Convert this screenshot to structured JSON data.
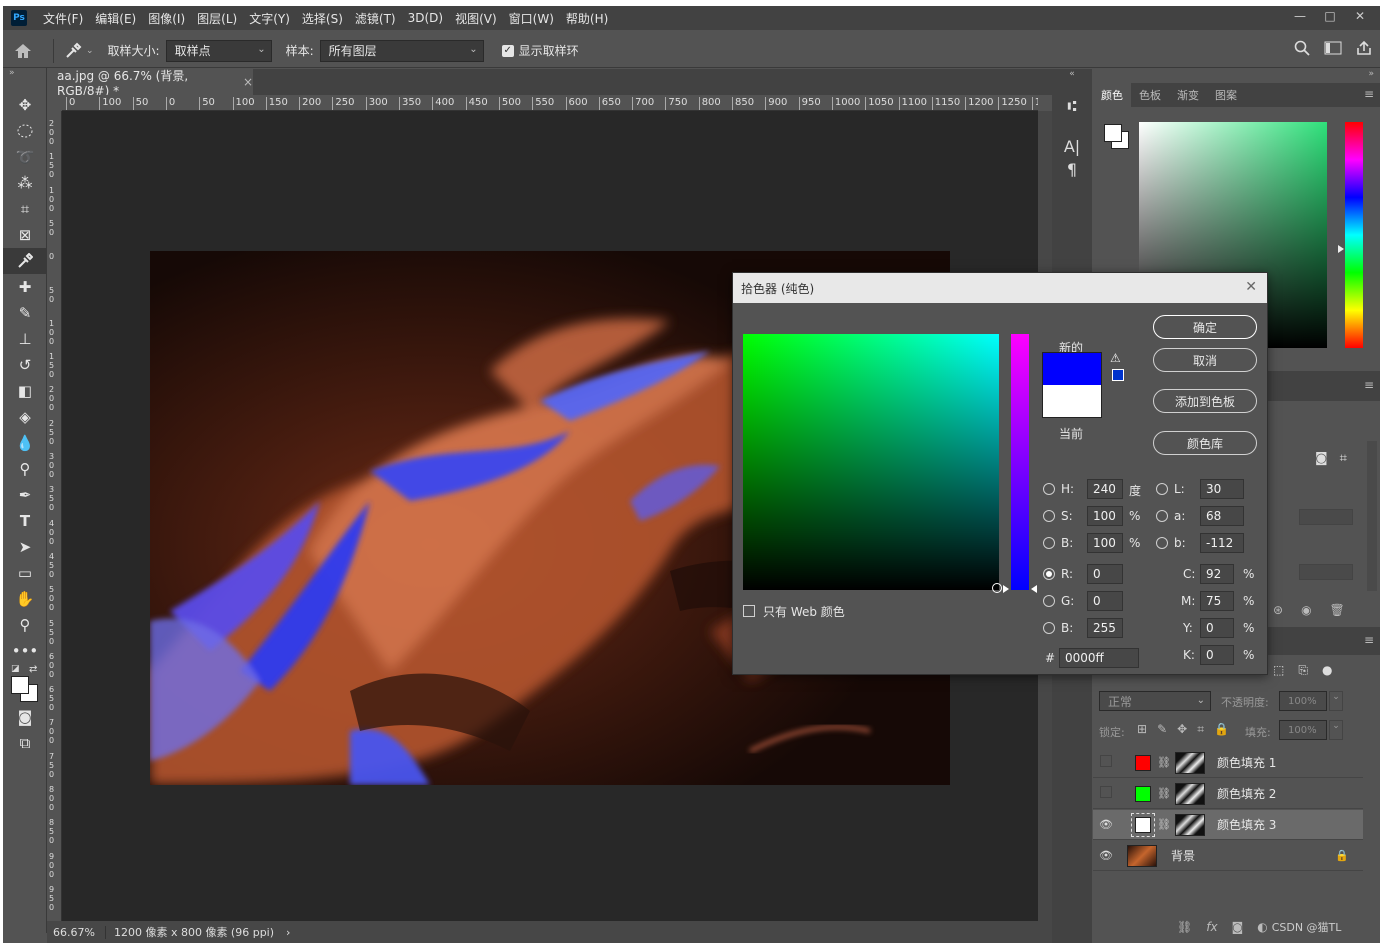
{
  "menubar": {
    "app_icon": "Ps",
    "items": [
      "文件(F)",
      "编辑(E)",
      "图像(I)",
      "图层(L)",
      "文字(Y)",
      "选择(S)",
      "滤镜(T)",
      "3D(D)",
      "视图(V)",
      "窗口(W)",
      "帮助(H)"
    ],
    "window_buttons": [
      "—",
      "□",
      "✕"
    ]
  },
  "options": {
    "sample_size_label": "取样大小:",
    "sample_size_value": "取样点",
    "sample_label": "样本:",
    "sample_value": "所有图层",
    "show_ring_label": "显示取样环",
    "show_ring_checked": true
  },
  "document": {
    "tab_title": "aa.jpg @ 66.7% (背景, RGB/8#) *",
    "close_glyph": "×",
    "ruler_top": [
      "0",
      "100",
      "50",
      "0",
      "50",
      "100",
      "150",
      "200",
      "250",
      "300",
      "350",
      "400",
      "450",
      "500",
      "550",
      "600",
      "650",
      "700",
      "750",
      "800",
      "850",
      "900",
      "950",
      "1000",
      "1050",
      "1100",
      "1150",
      "1200",
      "1250",
      "130"
    ],
    "ruler_left": [
      "200",
      "150",
      "100",
      "50",
      "0",
      "50",
      "100",
      "150",
      "200",
      "250",
      "300",
      "350",
      "400",
      "450",
      "500",
      "550",
      "600",
      "650",
      "700",
      "750",
      "800",
      "850",
      "900",
      "950"
    ]
  },
  "status": {
    "zoom": "66.67%",
    "info": "1200 像素 x 800 像素 (96 ppi)",
    "arrow": "›"
  },
  "right_panel": {
    "tabs": [
      "颜色",
      "色板",
      "渐变",
      "图案"
    ],
    "blend_mode": "正常",
    "opacity_label": "不透明度:",
    "opacity_value": "100%",
    "lock_label": "锁定:",
    "fill_label": "填充:",
    "fill_value": "100%",
    "layers": [
      {
        "name": "颜色填充 1",
        "color": "#ff0000",
        "visible": false,
        "selected": false
      },
      {
        "name": "颜色填充 2",
        "color": "#00ff00",
        "visible": false,
        "selected": false
      },
      {
        "name": "颜色填充 3",
        "color": "#ffffff",
        "visible": true,
        "selected": true
      },
      {
        "name": "背景",
        "visible": true,
        "selected": false
      }
    ],
    "footer_watermark": "CSDN @猫TL"
  },
  "picker": {
    "title": "拾色器 (纯色)",
    "new_label": "新的",
    "current_label": "当前",
    "new_color": "#0000ff",
    "current_color": "#ffffff",
    "ok": "确定",
    "cancel": "取消",
    "add_swatch": "添加到色板",
    "color_library": "颜色库",
    "web_only_label": "只有 Web 颜色",
    "H": {
      "label": "H:",
      "value": "240",
      "unit": "度"
    },
    "S": {
      "label": "S:",
      "value": "100",
      "unit": "%"
    },
    "Bv": {
      "label": "B:",
      "value": "100",
      "unit": "%"
    },
    "R": {
      "label": "R:",
      "value": "0"
    },
    "G": {
      "label": "G:",
      "value": "0"
    },
    "Bc": {
      "label": "B:",
      "value": "255"
    },
    "L": {
      "label": "L:",
      "value": "30"
    },
    "a": {
      "label": "a:",
      "value": "68"
    },
    "b": {
      "label": "b:",
      "value": "-112"
    },
    "C": {
      "label": "C:",
      "value": "92",
      "unit": "%"
    },
    "M": {
      "label": "M:",
      "value": "75",
      "unit": "%"
    },
    "Y": {
      "label": "Y:",
      "value": "0",
      "unit": "%"
    },
    "K": {
      "label": "K:",
      "value": "0",
      "unit": "%"
    },
    "hex_label": "#",
    "hex": "0000ff"
  }
}
